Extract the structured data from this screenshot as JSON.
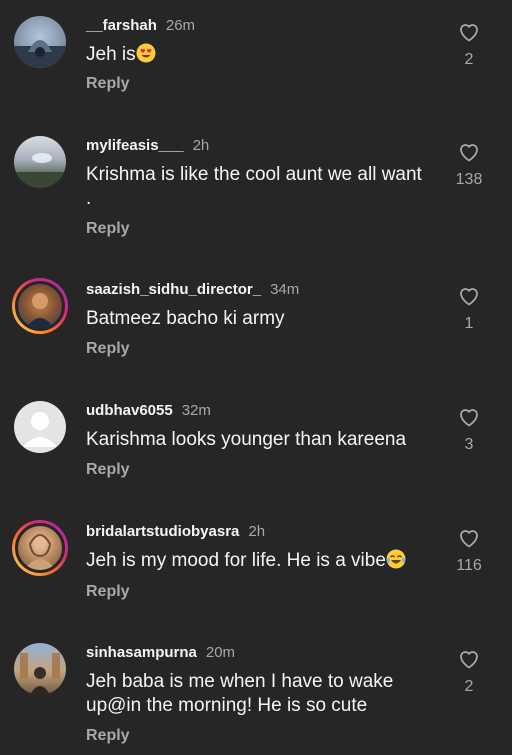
{
  "comments": [
    {
      "username": "__farshah",
      "time": "26m",
      "text": "Jeh is",
      "emoji": "heart-eyes-emoji",
      "reply_label": "Reply",
      "likes": "2"
    },
    {
      "username": "mylifeasis___",
      "time": "2h",
      "text": "Krishma is like the cool aunt we all want .",
      "reply_label": "Reply",
      "likes": "138"
    },
    {
      "username": "saazish_sidhu_director_",
      "time": "34m",
      "text": "Batmeez bacho ki army",
      "reply_label": "Reply",
      "likes": "1"
    },
    {
      "username": "udbhav6055",
      "time": "32m",
      "text": "Karishma looks younger than kareena",
      "reply_label": "Reply",
      "likes": "3"
    },
    {
      "username": "bridalartstudiobyasra",
      "time": "2h",
      "text": "Jeh is my mood for life. He is a vibe",
      "emoji": "tears-of-joy-emoji",
      "reply_label": "Reply",
      "likes": "116"
    },
    {
      "username": "sinhasampurna",
      "time": "20m",
      "text": "Jeh baba is me when I have to wake up@in the morning! He is so cute",
      "reply_label": "Reply",
      "likes": "2"
    }
  ],
  "colors": {
    "background": "#262626",
    "primary_text": "#f5f5f5",
    "secondary_text": "#a8a8a8",
    "story_ring": "#d62976"
  }
}
